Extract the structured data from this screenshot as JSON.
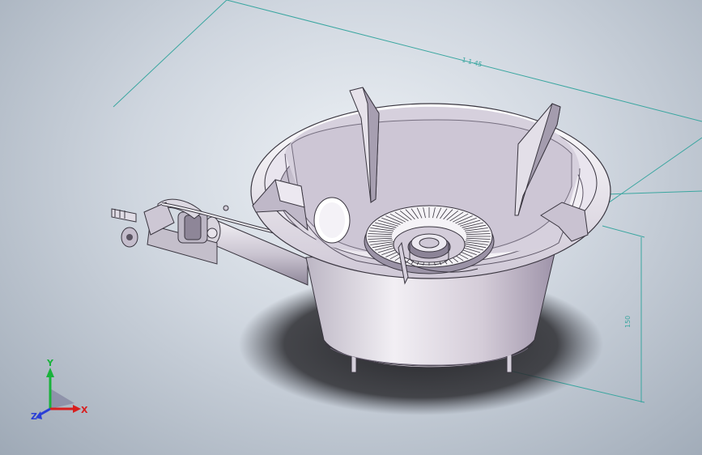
{
  "dimensions": {
    "top_width": "1 1 45",
    "height": "150"
  },
  "triad": {
    "x_label": "X",
    "y_label": "Y",
    "z_label": "Z",
    "x_color": "#d81e1e",
    "y_color": "#19b23b",
    "z_color": "#2a3fd6"
  },
  "colors": {
    "dimension_line": "#3aa6a0",
    "body": "#d8d4dc",
    "shadow": "#242428"
  }
}
